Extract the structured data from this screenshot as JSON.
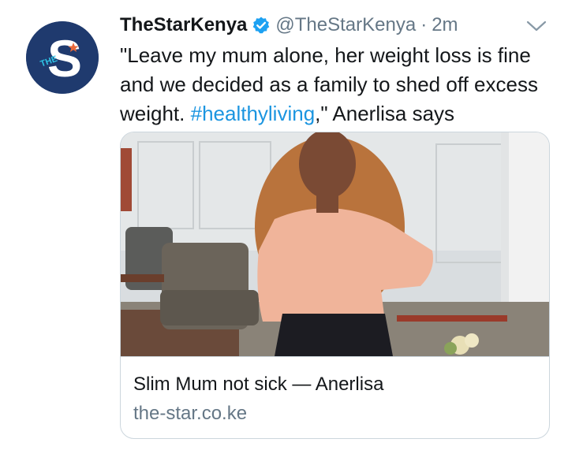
{
  "tweet": {
    "display_name": "TheStarKenya",
    "handle": "@TheStarKenya",
    "separator": "·",
    "time": "2m",
    "verified": true,
    "text_before_hashtag": "\"Leave my mum alone, her weight loss is fine and we decided as a family to shed off excess weight. ",
    "hashtag": "#healthyliving",
    "text_after_hashtag": ",\" Anerlisa says"
  },
  "avatar": {
    "logo_letter": "S",
    "logo_small_text": "THE",
    "background_color": "#1f3a6e",
    "star_color": "#e8683a"
  },
  "card": {
    "title": "Slim Mum not sick — Anerlisa",
    "domain": "the-star.co.ke"
  },
  "colors": {
    "verified_badge": "#1da1f2",
    "hashtag": "#1b95e0",
    "secondary_text": "#657786"
  },
  "icons": {
    "verified": "verified-badge-icon",
    "menu": "chevron-down-icon"
  }
}
